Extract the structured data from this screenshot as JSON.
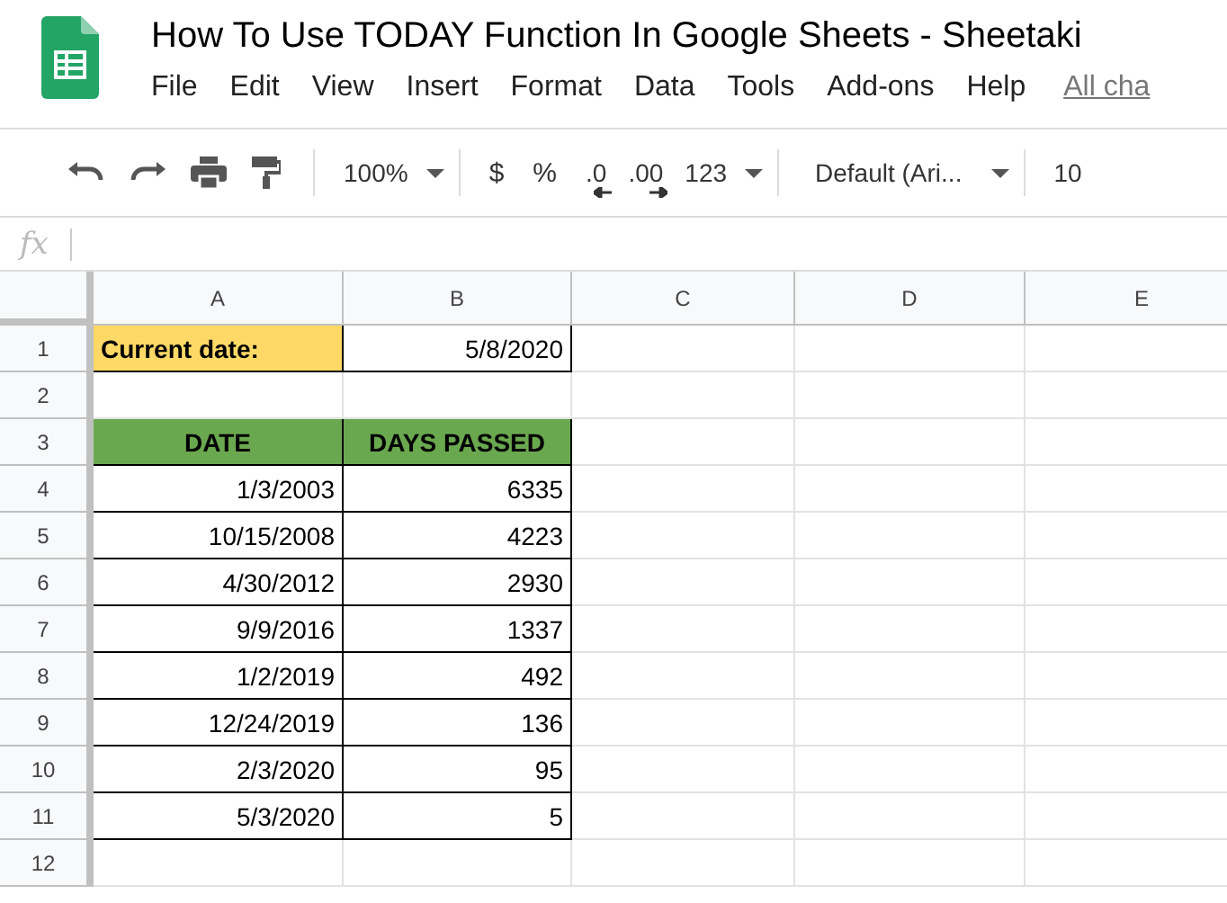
{
  "document": {
    "title": "How To Use TODAY Function In Google Sheets - Sheetaki"
  },
  "menu": [
    "File",
    "Edit",
    "View",
    "Insert",
    "Format",
    "Data",
    "Tools",
    "Add-ons",
    "Help"
  ],
  "last_edit_link": "All cha",
  "toolbar": {
    "zoom": "100%",
    "currency": "$",
    "percent": "%",
    "decrease_decimals": ".0",
    "increase_decimals": ".00",
    "number_format": "123",
    "font": "Default (Ari...",
    "font_size": "10"
  },
  "formula_bar": {
    "fx": "fx"
  },
  "columns": [
    "A",
    "B",
    "C",
    "D",
    "E"
  ],
  "rows": [
    {
      "number": "1",
      "cells": [
        {
          "text": "Current date:",
          "kind": "label"
        },
        {
          "text": "5/8/2020",
          "kind": "value"
        }
      ]
    },
    {
      "number": "2",
      "cells": []
    },
    {
      "number": "3",
      "cells": [
        {
          "text": "DATE",
          "kind": "header"
        },
        {
          "text": "DAYS PASSED",
          "kind": "header"
        }
      ]
    },
    {
      "number": "4",
      "cells": [
        {
          "text": "1/3/2003",
          "kind": "value"
        },
        {
          "text": "6335",
          "kind": "value"
        }
      ]
    },
    {
      "number": "5",
      "cells": [
        {
          "text": "10/15/2008",
          "kind": "value"
        },
        {
          "text": "4223",
          "kind": "value"
        }
      ]
    },
    {
      "number": "6",
      "cells": [
        {
          "text": "4/30/2012",
          "kind": "value"
        },
        {
          "text": "2930",
          "kind": "value"
        }
      ]
    },
    {
      "number": "7",
      "cells": [
        {
          "text": "9/9/2016",
          "kind": "value"
        },
        {
          "text": "1337",
          "kind": "value"
        }
      ]
    },
    {
      "number": "8",
      "cells": [
        {
          "text": "1/2/2019",
          "kind": "value"
        },
        {
          "text": "492",
          "kind": "value"
        }
      ]
    },
    {
      "number": "9",
      "cells": [
        {
          "text": "12/24/2019",
          "kind": "value"
        },
        {
          "text": "136",
          "kind": "value"
        }
      ]
    },
    {
      "number": "10",
      "cells": [
        {
          "text": "2/3/2020",
          "kind": "value"
        },
        {
          "text": "95",
          "kind": "value"
        }
      ]
    },
    {
      "number": "11",
      "cells": [
        {
          "text": "5/3/2020",
          "kind": "value"
        },
        {
          "text": "5",
          "kind": "value"
        }
      ]
    },
    {
      "number": "12",
      "cells": []
    }
  ]
}
